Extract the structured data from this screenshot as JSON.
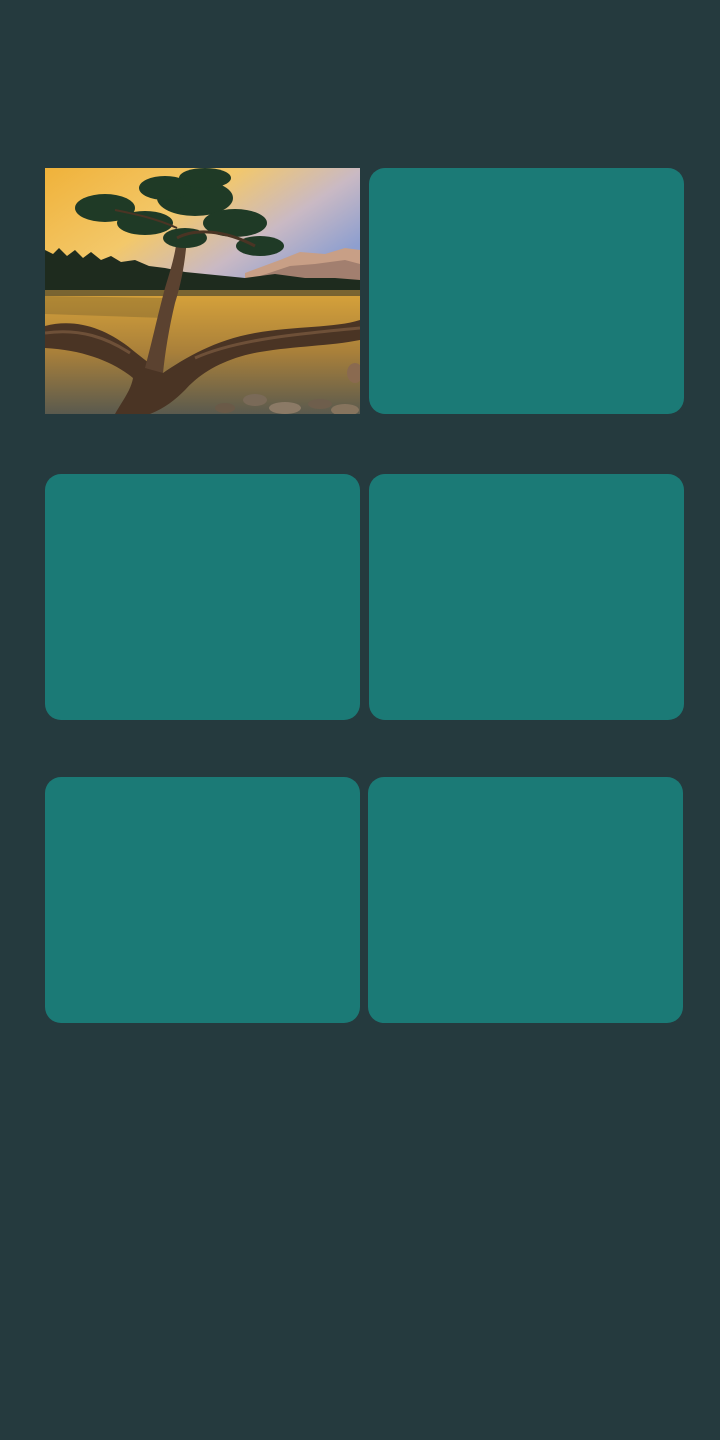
{
  "screen": {
    "background_color": "#253a3e"
  },
  "tiles": [
    {
      "id": 1,
      "state": "revealed",
      "image": "sunset-lake-tree-photo"
    },
    {
      "id": 2,
      "state": "hidden",
      "color": "#1b7a76"
    },
    {
      "id": 3,
      "state": "hidden",
      "color": "#1b7a76"
    },
    {
      "id": 4,
      "state": "hidden",
      "color": "#1b7a76"
    },
    {
      "id": 5,
      "state": "hidden",
      "color": "#1b7a76"
    },
    {
      "id": 6,
      "state": "hidden",
      "color": "#1b7a76"
    }
  ]
}
